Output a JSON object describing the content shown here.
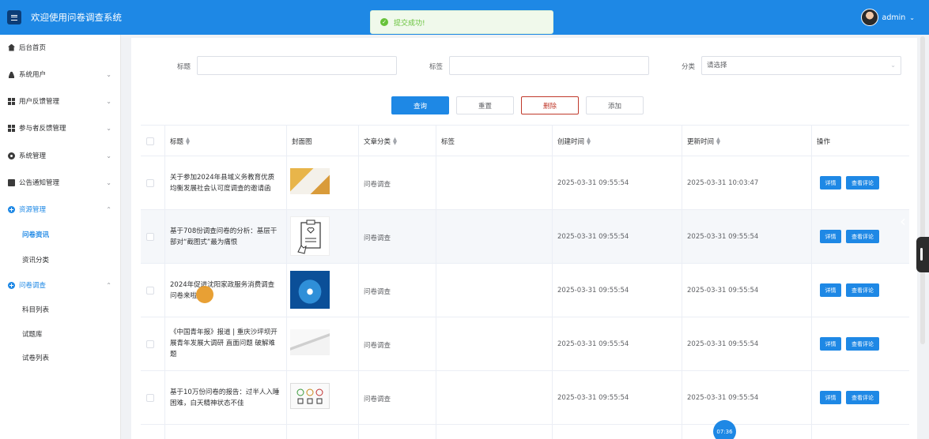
{
  "app": {
    "title": "欢迎使用问卷调查系统",
    "user": "admin",
    "user_chevron": "⌄",
    "menu_icon": "menu-icon"
  },
  "toast": {
    "message": "提交成功!",
    "type": "success"
  },
  "sidebar": {
    "items": [
      {
        "label": "后台首页",
        "icon": "home-icon"
      },
      {
        "label": "系统用户",
        "icon": "user-icon",
        "expandable": true
      },
      {
        "label": "用户反馈管理",
        "icon": "grid-icon",
        "expandable": true
      },
      {
        "label": "参与者反馈管理",
        "icon": "grid-icon",
        "expandable": true
      },
      {
        "label": "系统管理",
        "icon": "gear-icon",
        "expandable": true
      },
      {
        "label": "公告通知管理",
        "icon": "doc-icon",
        "expandable": true
      },
      {
        "label": "资源管理",
        "icon": "plus-circle-icon",
        "expanded": true,
        "children": [
          {
            "label": "问卷资讯",
            "active": true
          },
          {
            "label": "资讯分类"
          }
        ]
      },
      {
        "label": "问卷调查",
        "icon": "plus-circle-icon",
        "expanded": true,
        "children": [
          {
            "label": "科目列表"
          },
          {
            "label": "试题库"
          },
          {
            "label": "试卷列表"
          }
        ]
      }
    ]
  },
  "filters": {
    "title_label": "标题",
    "title_value": "",
    "tag_label": "标签",
    "tag_value": "",
    "category_label": "分类",
    "category_placeholder": "请选择"
  },
  "actions": {
    "search": "查询",
    "reset": "重置",
    "delete": "删除",
    "add": "添加"
  },
  "table": {
    "headers": [
      "标题",
      "封面图",
      "文章分类",
      "标签",
      "创建时间",
      "更新时间",
      "操作"
    ],
    "detail_label": "详情",
    "comments_label": "查看评论",
    "rows": [
      {
        "title": "关于参加2024年县域义务教育优质均衡发展社会认可度调查的邀请函",
        "thumb": "paper",
        "category": "问卷调查",
        "tag": "",
        "created": "2025-03-31 09:55:54",
        "updated": "2025-03-31 10:03:47"
      },
      {
        "title": "基于708份调查问卷的分析：基层干部对“截图式”最为痛恨",
        "thumb": "clipboard",
        "category": "问卷调查",
        "tag": "",
        "created": "2025-03-31 09:55:54",
        "updated": "2025-03-31 09:55:54"
      },
      {
        "title": "2024年促进沈阳家政服务消费调查问卷来啦",
        "thumb": "blue",
        "category": "问卷调查",
        "tag": "",
        "created": "2025-03-31 09:55:54",
        "updated": "2025-03-31 09:55:54"
      },
      {
        "title": "《中国青年报》报道 | 重庆沙坪坝开展青年发展大调研 直面问题 破解难题",
        "thumb": "pen",
        "category": "问卷调查",
        "tag": "",
        "created": "2025-03-31 09:55:54",
        "updated": "2025-03-31 09:55:54"
      },
      {
        "title": "基于10万份问卷的报告：过半人入睡困难，白天精神状态不佳",
        "thumb": "checklist",
        "category": "问卷调查",
        "tag": "",
        "created": "2025-03-31 09:55:54",
        "updated": "2025-03-31 09:55:54"
      }
    ]
  },
  "clock": "07:36",
  "colors": {
    "primary": "#1e88e5",
    "danger": "#c0392b",
    "success": "#67c23a"
  }
}
